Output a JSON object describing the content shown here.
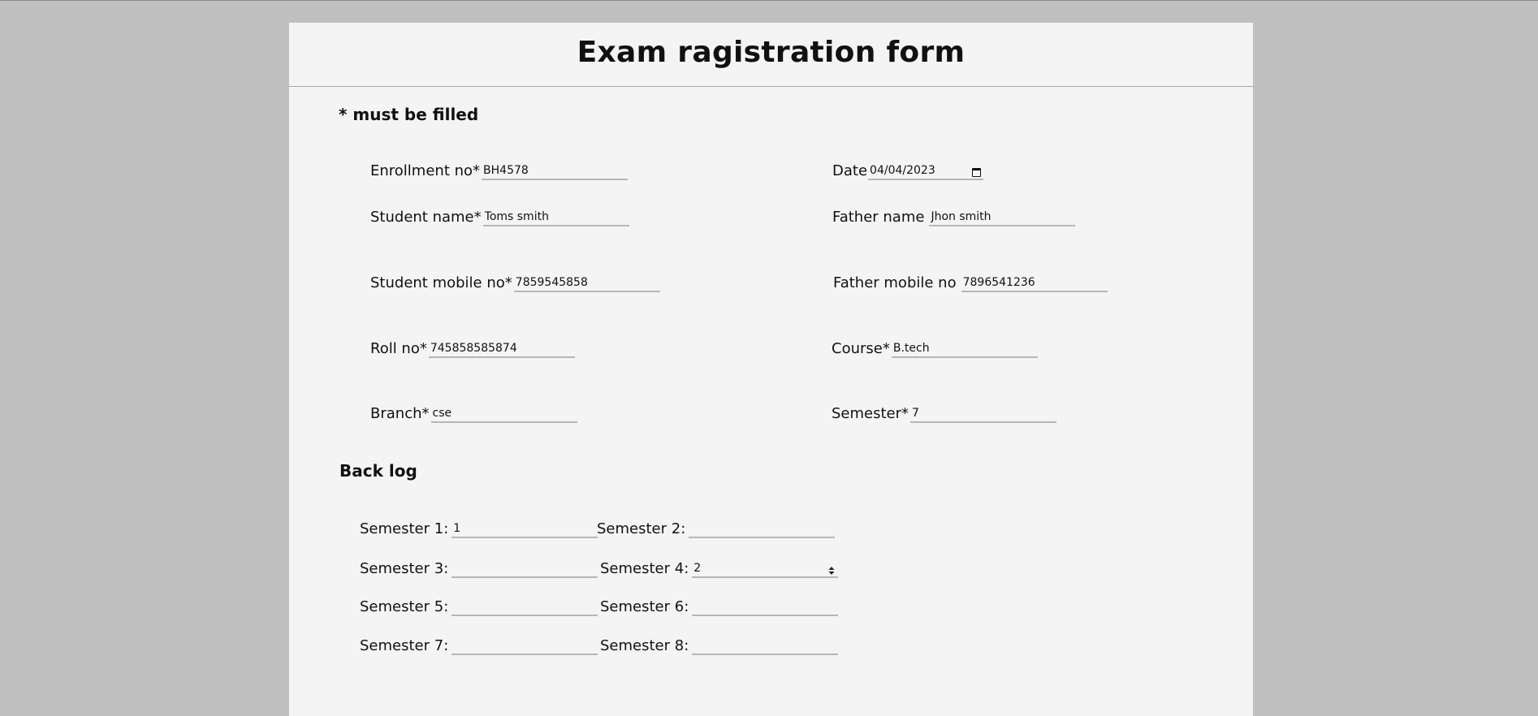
{
  "title": "Exam ragistration form",
  "required_note": "* must be filled",
  "required_mark": "*",
  "fields": {
    "enrollment": {
      "label": "Enrollment no",
      "value": "BH4578"
    },
    "date": {
      "label": "Date",
      "value": "04/04/2023",
      "icon": "calendar-icon"
    },
    "student_name": {
      "label": "Student name",
      "value": "Toms smith"
    },
    "father_name": {
      "label": "Father name",
      "value": "Jhon smith"
    },
    "student_mobile": {
      "label": "Student mobile no",
      "value": "7859545858"
    },
    "father_mobile": {
      "label": "Father mobile no",
      "value": "7896541236"
    },
    "roll": {
      "label": "Roll no",
      "value": "745858585874"
    },
    "course": {
      "label": "Course",
      "value": "B.tech"
    },
    "branch": {
      "label": "Branch",
      "value": "cse"
    },
    "semester": {
      "label": "Semester",
      "value": "7"
    }
  },
  "backlog": {
    "title": "Back log",
    "semesters": [
      {
        "label": "Semester 1:",
        "value": "1"
      },
      {
        "label": "Semester 2:",
        "value": ""
      },
      {
        "label": "Semester 3:",
        "value": ""
      },
      {
        "label": "Semester 4:",
        "value": "2",
        "icon": "spinner-arrows-icon"
      },
      {
        "label": "Semester 5:",
        "value": ""
      },
      {
        "label": "Semester 6:",
        "value": ""
      },
      {
        "label": "Semester 7:",
        "value": ""
      },
      {
        "label": "Semester 8:",
        "value": ""
      }
    ]
  }
}
